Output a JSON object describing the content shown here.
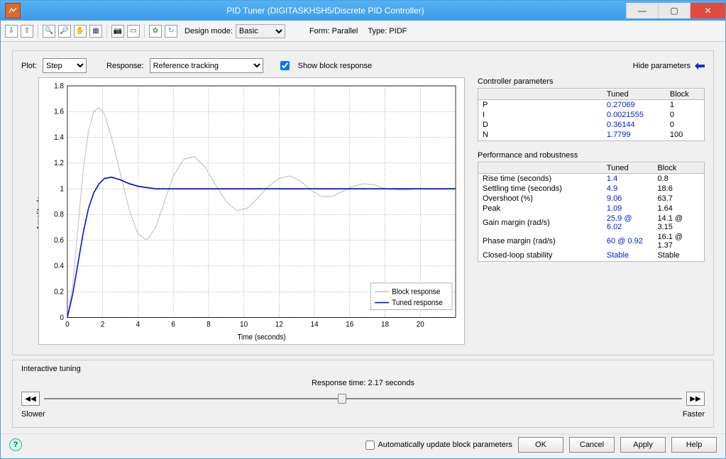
{
  "window": {
    "title": "PID Tuner (DIGITASKHSH5/Discrete PID Controller)"
  },
  "toolbar": {
    "design_mode_label": "Design mode:",
    "design_mode_value": "Basic",
    "form_label": "Form: Parallel",
    "type_label": "Type: PIDF"
  },
  "controls": {
    "plot_label": "Plot:",
    "plot_value": "Step",
    "response_label": "Response:",
    "response_value": "Reference tracking",
    "show_block_response": "Show block response",
    "hide_parameters": "Hide parameters"
  },
  "chart_data": {
    "type": "line",
    "title": "",
    "xlabel": "Time (seconds)",
    "ylabel": "Amplitude",
    "xlim": [
      0,
      22
    ],
    "ylim": [
      0,
      1.8
    ],
    "xticks": [
      0,
      2,
      4,
      6,
      8,
      10,
      12,
      14,
      16,
      18,
      20
    ],
    "yticks": [
      0,
      0.2,
      0.4,
      0.6,
      0.8,
      1,
      1.2,
      1.4,
      1.6,
      1.8
    ],
    "legend": [
      "Block response",
      "Tuned response"
    ],
    "series": [
      {
        "name": "Block response",
        "color": "#bdbdbd",
        "x": [
          0,
          0.3,
          0.6,
          0.9,
          1.2,
          1.5,
          1.8,
          2.1,
          2.5,
          3.0,
          3.5,
          4.0,
          4.5,
          5.0,
          5.5,
          6.0,
          6.6,
          7.2,
          7.8,
          8.4,
          9.0,
          9.6,
          10.2,
          10.8,
          11.4,
          12.0,
          12.6,
          13.2,
          13.8,
          14.4,
          15.0,
          15.6,
          16.2,
          16.8,
          17.4,
          18.0,
          19.0,
          20.0,
          21.0,
          22.0
        ],
        "y": [
          0,
          0.25,
          0.7,
          1.15,
          1.45,
          1.6,
          1.63,
          1.58,
          1.4,
          1.12,
          0.84,
          0.65,
          0.6,
          0.7,
          0.9,
          1.1,
          1.23,
          1.25,
          1.17,
          1.03,
          0.9,
          0.83,
          0.85,
          0.93,
          1.02,
          1.08,
          1.1,
          1.06,
          0.99,
          0.94,
          0.94,
          0.98,
          1.02,
          1.04,
          1.03,
          1.0,
          0.99,
          1.0,
          1.0,
          1.0
        ]
      },
      {
        "name": "Tuned response",
        "color": "#0018d4",
        "x": [
          0,
          0.3,
          0.6,
          0.9,
          1.2,
          1.5,
          1.8,
          2.1,
          2.5,
          3.0,
          3.5,
          4.0,
          4.5,
          5.0,
          5.5,
          6.0,
          7.0,
          8.0,
          9.0,
          10.0,
          12.0,
          14.0,
          16.0,
          18.0,
          20.0,
          22.0
        ],
        "y": [
          0,
          0.18,
          0.42,
          0.66,
          0.85,
          0.97,
          1.04,
          1.08,
          1.09,
          1.07,
          1.04,
          1.02,
          1.01,
          1.0,
          1.0,
          1.0,
          1.0,
          1.0,
          1.0,
          1.0,
          1.0,
          1.0,
          1.0,
          1.0,
          1.0,
          1.0
        ]
      }
    ]
  },
  "controller_params": {
    "title": "Controller parameters",
    "headers": [
      "",
      "Tuned",
      "Block"
    ],
    "rows": [
      {
        "name": "P",
        "tuned": "0.27069",
        "block": "1"
      },
      {
        "name": "I",
        "tuned": "0.0021555",
        "block": "0"
      },
      {
        "name": "D",
        "tuned": "0.36144",
        "block": "0"
      },
      {
        "name": "N",
        "tuned": "1.7799",
        "block": "100"
      }
    ]
  },
  "performance": {
    "title": "Performance and robustness",
    "headers": [
      "",
      "Tuned",
      "Block"
    ],
    "rows": [
      {
        "name": "Rise time (seconds)",
        "tuned": "1.4",
        "block": "0.8"
      },
      {
        "name": "Settling time (seconds)",
        "tuned": "4.9",
        "block": "18.6"
      },
      {
        "name": "Overshoot (%)",
        "tuned": "9.06",
        "block": "63.7"
      },
      {
        "name": "Peak",
        "tuned": "1.09",
        "block": "1.64"
      },
      {
        "name": "Gain margin (rad/s)",
        "tuned": "25.9 @ 6.02",
        "block": "14.1 @ 3.15"
      },
      {
        "name": "Phase margin (rad/s)",
        "tuned": "60 @ 0.92",
        "block": "16.1 @ 1.37"
      },
      {
        "name": "Closed-loop stability",
        "tuned": "Stable",
        "block": "Stable"
      }
    ]
  },
  "tuning": {
    "title": "Interactive tuning",
    "response_time_label": "Response time: 2.17 seconds",
    "slower": "Slower",
    "faster": "Faster"
  },
  "footer": {
    "auto_update": "Automatically update block parameters",
    "ok": "OK",
    "cancel": "Cancel",
    "apply": "Apply",
    "help": "Help"
  }
}
